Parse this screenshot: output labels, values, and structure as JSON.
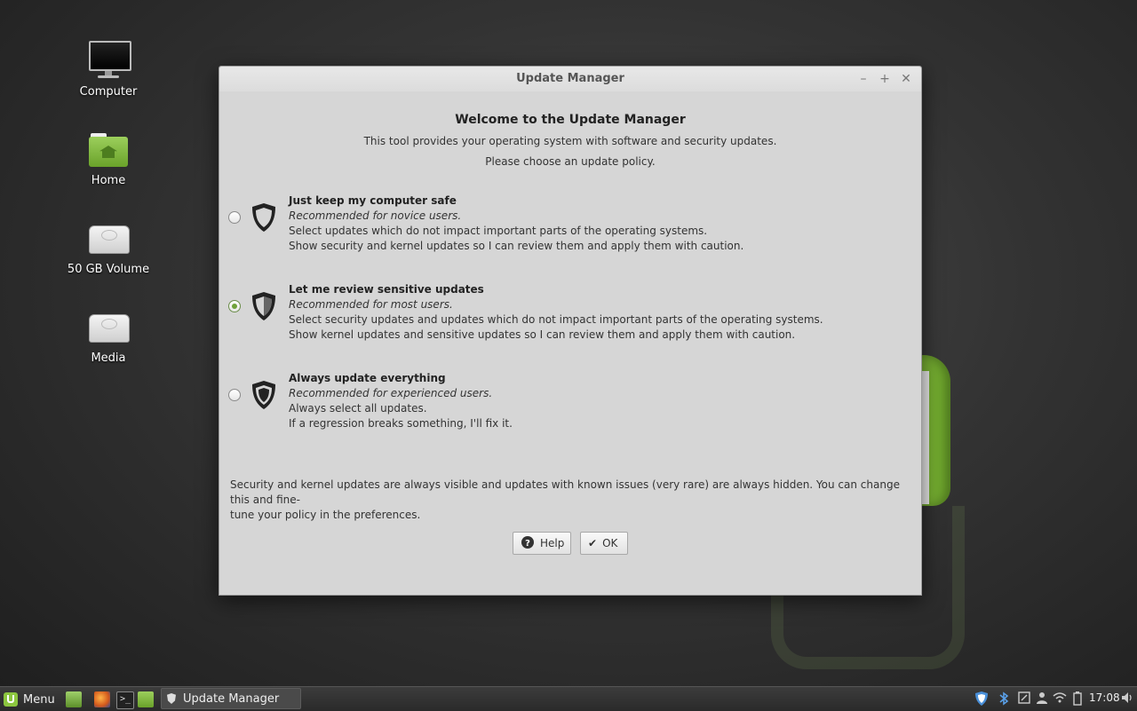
{
  "desktop": {
    "icons": [
      {
        "label": "Computer",
        "icon": "computer-icon"
      },
      {
        "label": "Home",
        "icon": "home-folder-icon"
      },
      {
        "label": "50 GB Volume",
        "icon": "drive-icon"
      },
      {
        "label": "Media",
        "icon": "drive-icon"
      }
    ]
  },
  "window": {
    "title": "Update Manager",
    "heading": "Welcome to the Update Manager",
    "intro": "This tool provides your operating system with software and security updates.",
    "prompt": "Please choose an update policy.",
    "options": [
      {
        "title": "Just keep my computer safe",
        "recommendation": "Recommended for novice users.",
        "line1": "Select updates which do not impact important parts of the operating systems.",
        "line2": "Show security and kernel updates so I can review them and apply them with caution.",
        "selected": false
      },
      {
        "title": "Let me review sensitive updates",
        "recommendation": "Recommended for most users.",
        "line1": "Select security updates and updates which do not impact important parts of the operating systems.",
        "line2": "Show kernel updates and sensitive updates so I can review them and apply them with caution.",
        "selected": true
      },
      {
        "title": "Always update everything",
        "recommendation": "Recommended for experienced users.",
        "line1": "Always select all updates.",
        "line2": "If a regression breaks something, I'll fix it.",
        "selected": false
      }
    ],
    "note_line1": "Security and kernel updates are always visible and updates with known issues (very rare) are always hidden. You can change this and fine-",
    "note_line2": "tune your policy in the preferences.",
    "help_label": "Help",
    "ok_label": "OK"
  },
  "taskbar": {
    "menu_label": "Menu",
    "task_label": "Update Manager",
    "clock": "17:08"
  },
  "colors": {
    "accent_green": "#8cc63f",
    "radio_selected": "#6fa23a"
  }
}
